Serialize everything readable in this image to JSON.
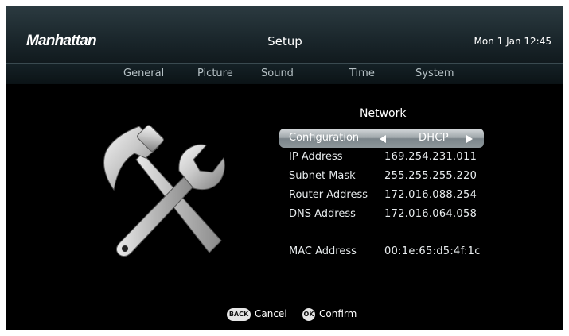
{
  "header": {
    "brand": "Manhattan",
    "title": "Setup",
    "datetime": "Mon 1 Jan 12:45"
  },
  "tabs": [
    {
      "label": "General"
    },
    {
      "label": "Picture"
    },
    {
      "label": "Sound"
    },
    {
      "label": "Time"
    },
    {
      "label": "System"
    }
  ],
  "network": {
    "title": "Network",
    "rows": [
      {
        "label": "Configuration",
        "value": "DHCP"
      },
      {
        "label": "IP Address",
        "value": "169.254.231.011"
      },
      {
        "label": "Subnet Mask",
        "value": "255.255.255.220"
      },
      {
        "label": "Router Address",
        "value": "172.016.088.254"
      },
      {
        "label": "DNS Address",
        "value": "172.016.064.058"
      },
      {
        "label": "MAC Address",
        "value": "00:1e:65:d5:4f:1c"
      }
    ]
  },
  "footer": {
    "back_key": "BACK",
    "back_label": "Cancel",
    "ok_key": "OK",
    "ok_label": "Confirm"
  },
  "icons": {
    "tools": "hammer-and-wrench-icon"
  }
}
